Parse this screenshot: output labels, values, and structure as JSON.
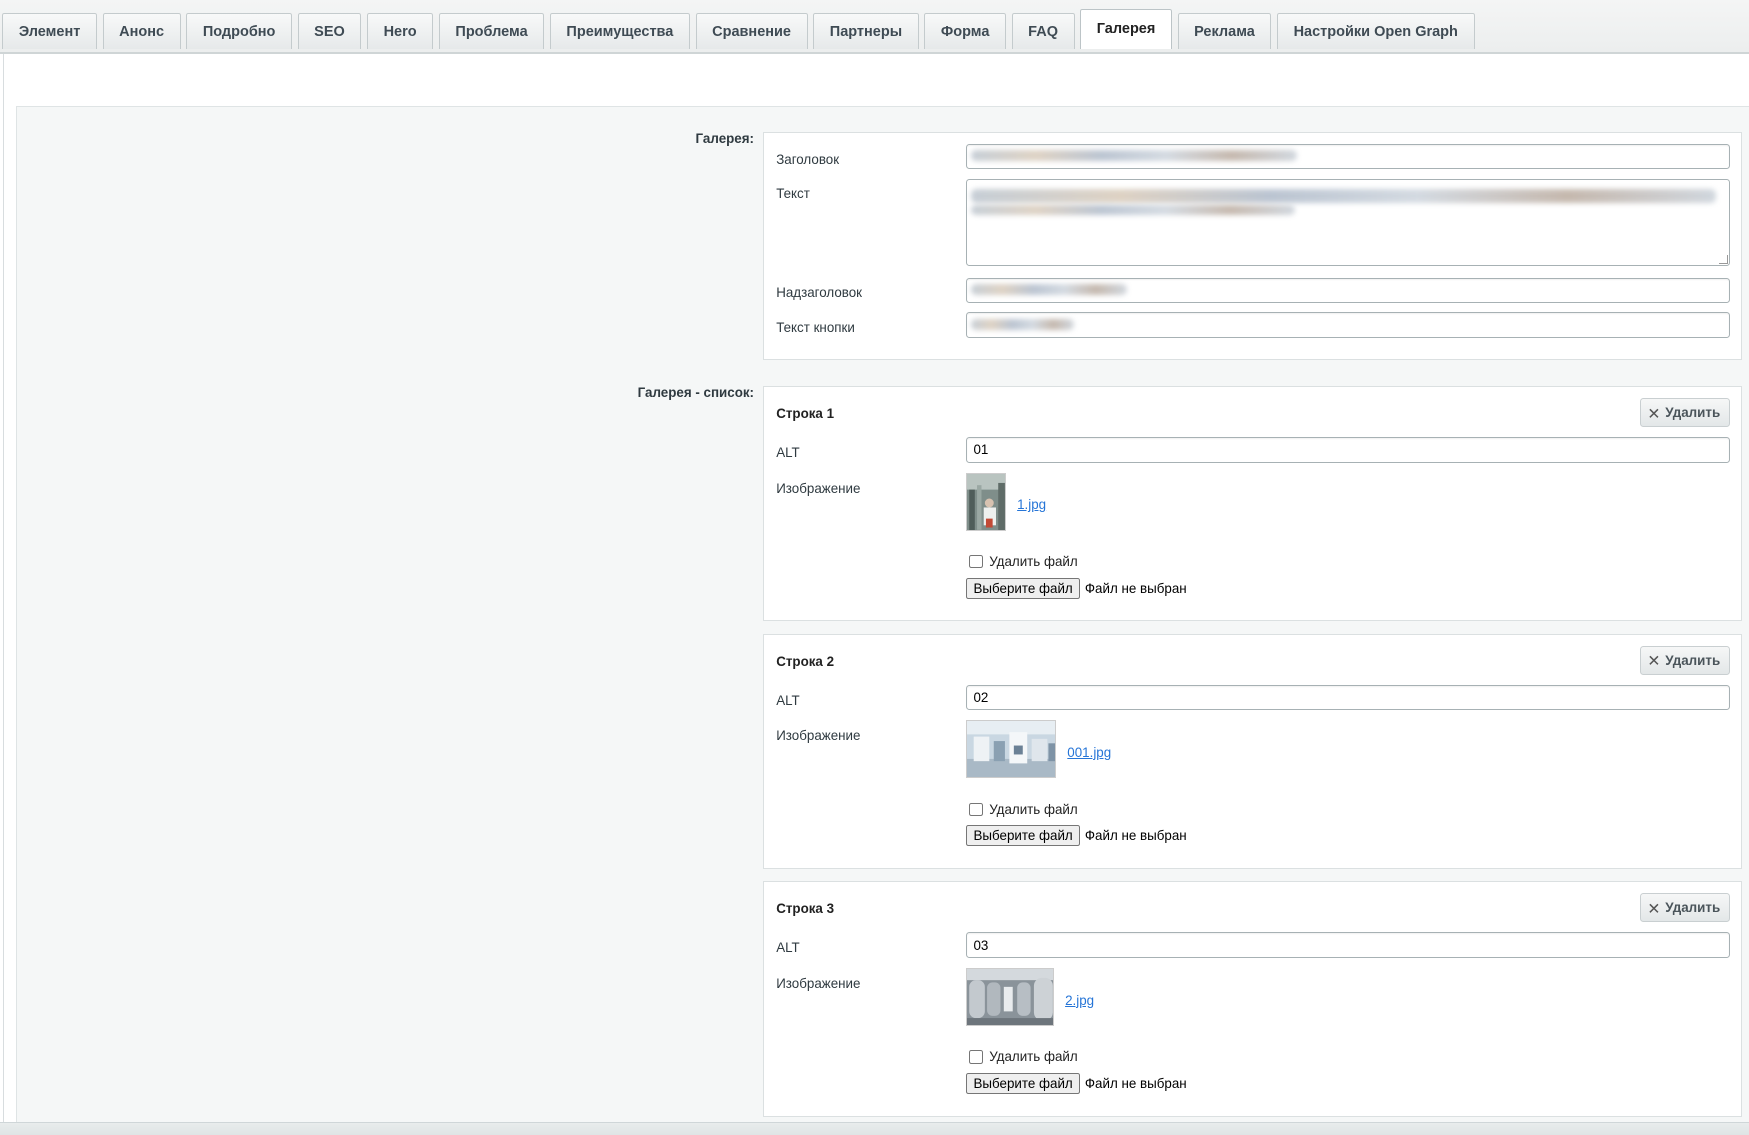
{
  "tabs": [
    {
      "label": "Элемент",
      "active": false
    },
    {
      "label": "Анонс",
      "active": false
    },
    {
      "label": "Подробно",
      "active": false
    },
    {
      "label": "SEO",
      "active": false
    },
    {
      "label": "Hero",
      "active": false
    },
    {
      "label": "Проблема",
      "active": false
    },
    {
      "label": "Преимущества",
      "active": false
    },
    {
      "label": "Сравнение",
      "active": false
    },
    {
      "label": "Партнеры",
      "active": false
    },
    {
      "label": "Форма",
      "active": false
    },
    {
      "label": "FAQ",
      "active": false
    },
    {
      "label": "Галерея",
      "active": true
    },
    {
      "label": "Реклама",
      "active": false
    },
    {
      "label": "Настройки Open Graph",
      "active": false
    }
  ],
  "gallery": {
    "section_label": "Галерея:",
    "fields": {
      "title_label": "Заголовок",
      "text_label": "Текст",
      "supertitle_label": "Надзаголовок",
      "button_text_label": "Текст кнопки"
    }
  },
  "gallery_list": {
    "section_label": "Галерея - список:",
    "rows": [
      {
        "title": "Строка 1",
        "delete_label": "Удалить",
        "alt_label": "ALT",
        "alt_value": "01",
        "image_label": "Изображение",
        "file_name": "1.jpg",
        "delete_file_label": "Удалить файл",
        "choose_file_label": "Выберите файл",
        "no_file_label": "Файл не выбран"
      },
      {
        "title": "Строка 2",
        "delete_label": "Удалить",
        "alt_label": "ALT",
        "alt_value": "02",
        "image_label": "Изображение",
        "file_name": "001.jpg",
        "delete_file_label": "Удалить файл",
        "choose_file_label": "Выберите файл",
        "no_file_label": "Файл не выбран"
      },
      {
        "title": "Строка 3",
        "delete_label": "Удалить",
        "alt_label": "ALT",
        "alt_value": "03",
        "image_label": "Изображение",
        "file_name": "2.jpg",
        "delete_file_label": "Удалить файл",
        "choose_file_label": "Выберите файл",
        "no_file_label": "Файл не выбран"
      }
    ]
  },
  "colors": {
    "link": "#2675d7",
    "panel_bg": "#f5f7f7",
    "tab_bg": "#e6e9ea"
  }
}
